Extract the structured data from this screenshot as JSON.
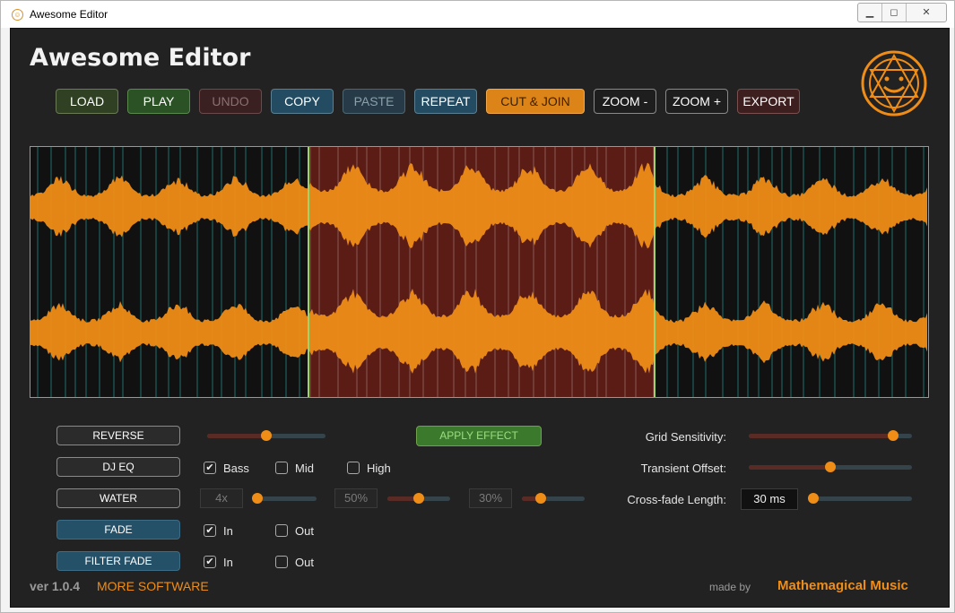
{
  "window": {
    "title": "Awesome Editor",
    "minimize_icon": "minimize-icon",
    "maximize_icon": "maximize-icon",
    "close_icon": "close-icon"
  },
  "app": {
    "title": "Awesome Editor",
    "logo_icon": "smiley-logo-icon"
  },
  "toolbar": {
    "buttons": [
      {
        "label": "LOAD",
        "bg": "#2f4023",
        "color": "#ffffff",
        "border": "#6b7b55"
      },
      {
        "label": "PLAY",
        "bg": "#2a5224",
        "color": "#ffffff",
        "border": "#5b8a4e"
      },
      {
        "label": "UNDO",
        "bg": "#3a2020",
        "color": "#8a7070",
        "border": "#6a4a4a"
      },
      {
        "label": "COPY",
        "bg": "#234c62",
        "color": "#ffffff",
        "border": "#5a7e92"
      },
      {
        "label": "PASTE",
        "bg": "#263b47",
        "color": "#8aa0aa",
        "border": "#4e6672"
      },
      {
        "label": "REPEAT",
        "bg": "#234c62",
        "color": "#ffffff",
        "border": "#5a7e92"
      },
      {
        "label": "CUT & JOIN",
        "bg": "#dd8418",
        "color": "#3a2200",
        "border": "#f0a64a"
      },
      {
        "label": "ZOOM -",
        "bg": "#1e1e1e",
        "color": "#ffffff",
        "border": "#8a8a8a"
      },
      {
        "label": "ZOOM +",
        "bg": "#1e1e1e",
        "color": "#ffffff",
        "border": "#8a8a8a"
      },
      {
        "label": "EXPORT",
        "bg": "#3d1f1f",
        "color": "#ffffff",
        "border": "#7a5050"
      }
    ]
  },
  "waveform": {
    "selection_start_fraction": 0.31,
    "selection_end_fraction": 0.695,
    "wave_color": "#ef8d17",
    "selection_color": "#5a1c14"
  },
  "effects": {
    "reverse": {
      "label": "REVERSE",
      "slider_value": 0.5
    },
    "apply_label": "APPLY EFFECT",
    "dj_eq": {
      "label": "DJ EQ",
      "bass": {
        "label": "Bass",
        "checked": true
      },
      "mid": {
        "label": "Mid",
        "checked": false
      },
      "high": {
        "label": "High",
        "checked": false
      }
    },
    "water": {
      "label": "WATER",
      "factor": "4x",
      "factor_value": 0.0,
      "pct1": "50%",
      "pct1_value": 0.5,
      "pct2": "30%",
      "pct2_value": 0.3
    },
    "fade": {
      "label": "FADE",
      "in": {
        "label": "In",
        "checked": true
      },
      "out": {
        "label": "Out",
        "checked": false
      }
    },
    "filter_fade": {
      "label": "FILTER FADE",
      "in": {
        "label": "In",
        "checked": true
      },
      "out": {
        "label": "Out",
        "checked": false
      }
    }
  },
  "settings": {
    "grid_sensitivity": {
      "label": "Grid Sensitivity:",
      "value": 0.88
    },
    "transient_offset": {
      "label": "Transient Offset:",
      "value": 0.5
    },
    "crossfade_length": {
      "label": "Cross-fade Length:",
      "value_text": "30 ms",
      "value": 0.0
    }
  },
  "footer": {
    "version": "ver 1.0.4",
    "more_link": "MORE SOFTWARE",
    "made_by": "made by",
    "company": "Mathemagical Music"
  }
}
